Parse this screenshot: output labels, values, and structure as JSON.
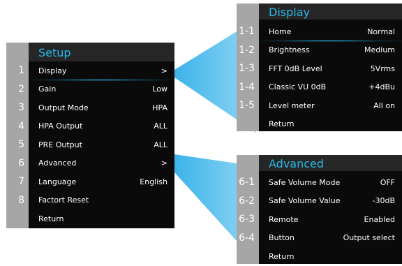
{
  "colors": {
    "accent": "#29b8ea",
    "panel_bg": "#0a0a0a",
    "gutter": "#a6a6a6",
    "beam": "#3fb6ec"
  },
  "setup": {
    "title": "Setup",
    "items": [
      {
        "num": "1",
        "label": "Display",
        "value": ">"
      },
      {
        "num": "2",
        "label": "Gain",
        "value": "Low"
      },
      {
        "num": "3",
        "label": "Output Mode",
        "value": "HPA"
      },
      {
        "num": "4",
        "label": "HPA Output",
        "value": "ALL"
      },
      {
        "num": "5",
        "label": "PRE Output",
        "value": "ALL"
      },
      {
        "num": "6",
        "label": "Advanced",
        "value": ">"
      },
      {
        "num": "7",
        "label": "Language",
        "value": "English"
      },
      {
        "num": "8",
        "label": "Factort Reset",
        "value": ""
      },
      {
        "num": "",
        "label": "Return",
        "value": ""
      }
    ]
  },
  "display": {
    "title": "Display",
    "items": [
      {
        "num": "1-1",
        "label": "Home",
        "value": "Normal"
      },
      {
        "num": "1-2",
        "label": "Brightness",
        "value": "Medium"
      },
      {
        "num": "1-3",
        "label": "FFT 0dB Level",
        "value": "5Vrms"
      },
      {
        "num": "1-4",
        "label": "Classic VU 0dB",
        "value": "+4dBu"
      },
      {
        "num": "1-5",
        "label": "Level meter",
        "value": "All on"
      },
      {
        "num": "",
        "label": "Return",
        "value": ""
      }
    ]
  },
  "advanced": {
    "title": "Advanced",
    "items": [
      {
        "num": "6-1",
        "label": "Safe Volume Mode",
        "value": "OFF"
      },
      {
        "num": "6-2",
        "label": "Safe Volume Value",
        "value": "-30dB"
      },
      {
        "num": "6-3",
        "label": "Remote",
        "value": "Enabled"
      },
      {
        "num": "6-4",
        "label": "Button",
        "value": "Output select"
      },
      {
        "num": "",
        "label": "Return",
        "value": ""
      }
    ]
  }
}
